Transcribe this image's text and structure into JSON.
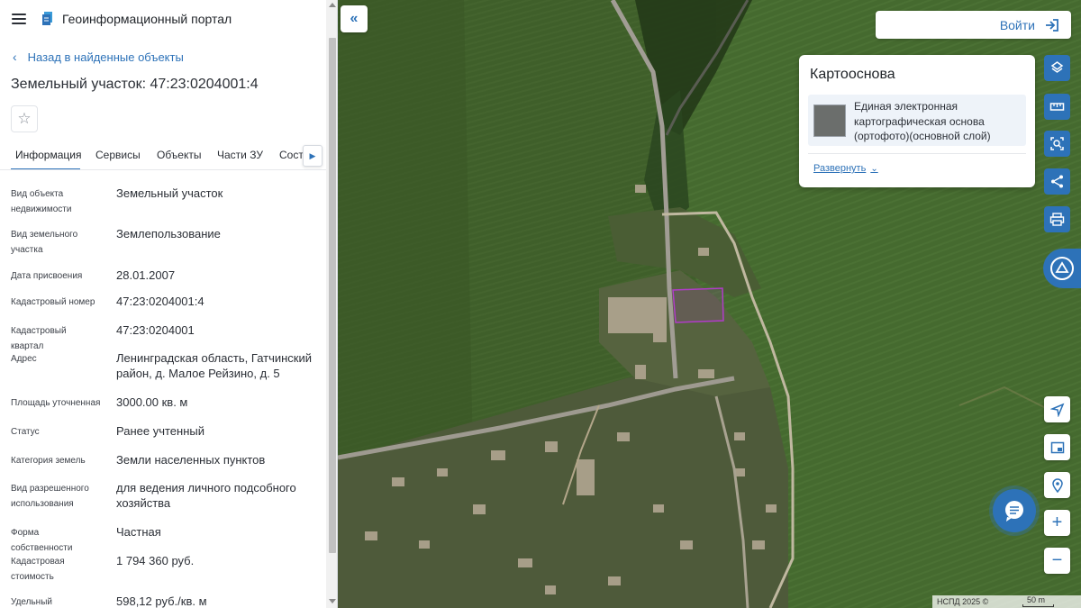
{
  "app": {
    "title": "Геоинформационный портал"
  },
  "nav": {
    "back_label": "Назад в найденные объекты"
  },
  "object": {
    "title": "Земельный участок: 47:23:0204001:4"
  },
  "tabs": [
    {
      "label": "Информация",
      "active": true
    },
    {
      "label": "Сервисы",
      "active": false
    },
    {
      "label": "Объекты",
      "active": false
    },
    {
      "label": "Части ЗУ",
      "active": false
    },
    {
      "label": "Состав",
      "active": false
    }
  ],
  "properties": [
    {
      "label": "Вид объекта недвижимости",
      "value": "Земельный участок"
    },
    {
      "label": "Вид земельного участка",
      "value": "Землепользование"
    },
    {
      "label": "Дата присвоения",
      "value": "28.01.2007"
    },
    {
      "label": "Кадастровый номер",
      "value": "47:23:0204001:4"
    },
    {
      "label": "Кадастровый квартал",
      "value": "47:23:0204001"
    },
    {
      "label": "Адрес",
      "value": "Ленинградская область, Гатчинский район, д. Малое Рейзино, д. 5"
    },
    {
      "label": "Площадь уточненная",
      "value": "3000.00 кв. м"
    },
    {
      "label": "Статус",
      "value": "Ранее учтенный"
    },
    {
      "label": "Категория земель",
      "value": "Земли населенных пунктов"
    },
    {
      "label": "Вид разрешенного использования",
      "value": "для ведения личного подсобного хозяйства"
    },
    {
      "label": "Форма собственности",
      "value": "Частная"
    },
    {
      "label": "Кадастровая стоимость",
      "value": "1 794 360 руб."
    },
    {
      "label": "Удельный показатель",
      "value": "598,12 руб./кв. м"
    }
  ],
  "map": {
    "login_label": "Войти",
    "basemap": {
      "title": "Картооснова",
      "layer_name": "Единая электронная картографическая основа (ортофото)(основной слой)",
      "expand_label": "Развернуть"
    },
    "tools": [
      "layers-icon",
      "ruler-icon",
      "select-area-icon",
      "share-icon",
      "print-icon",
      "navigate-icon",
      "minimap-icon",
      "location-pin-icon",
      "zoom-in-icon",
      "zoom-out-icon"
    ],
    "attribution": "НСПД 2025 ©",
    "scale_label": "50 m"
  },
  "colors": {
    "accent": "#2d72b8",
    "parcel_outline": "#b13cc9"
  }
}
